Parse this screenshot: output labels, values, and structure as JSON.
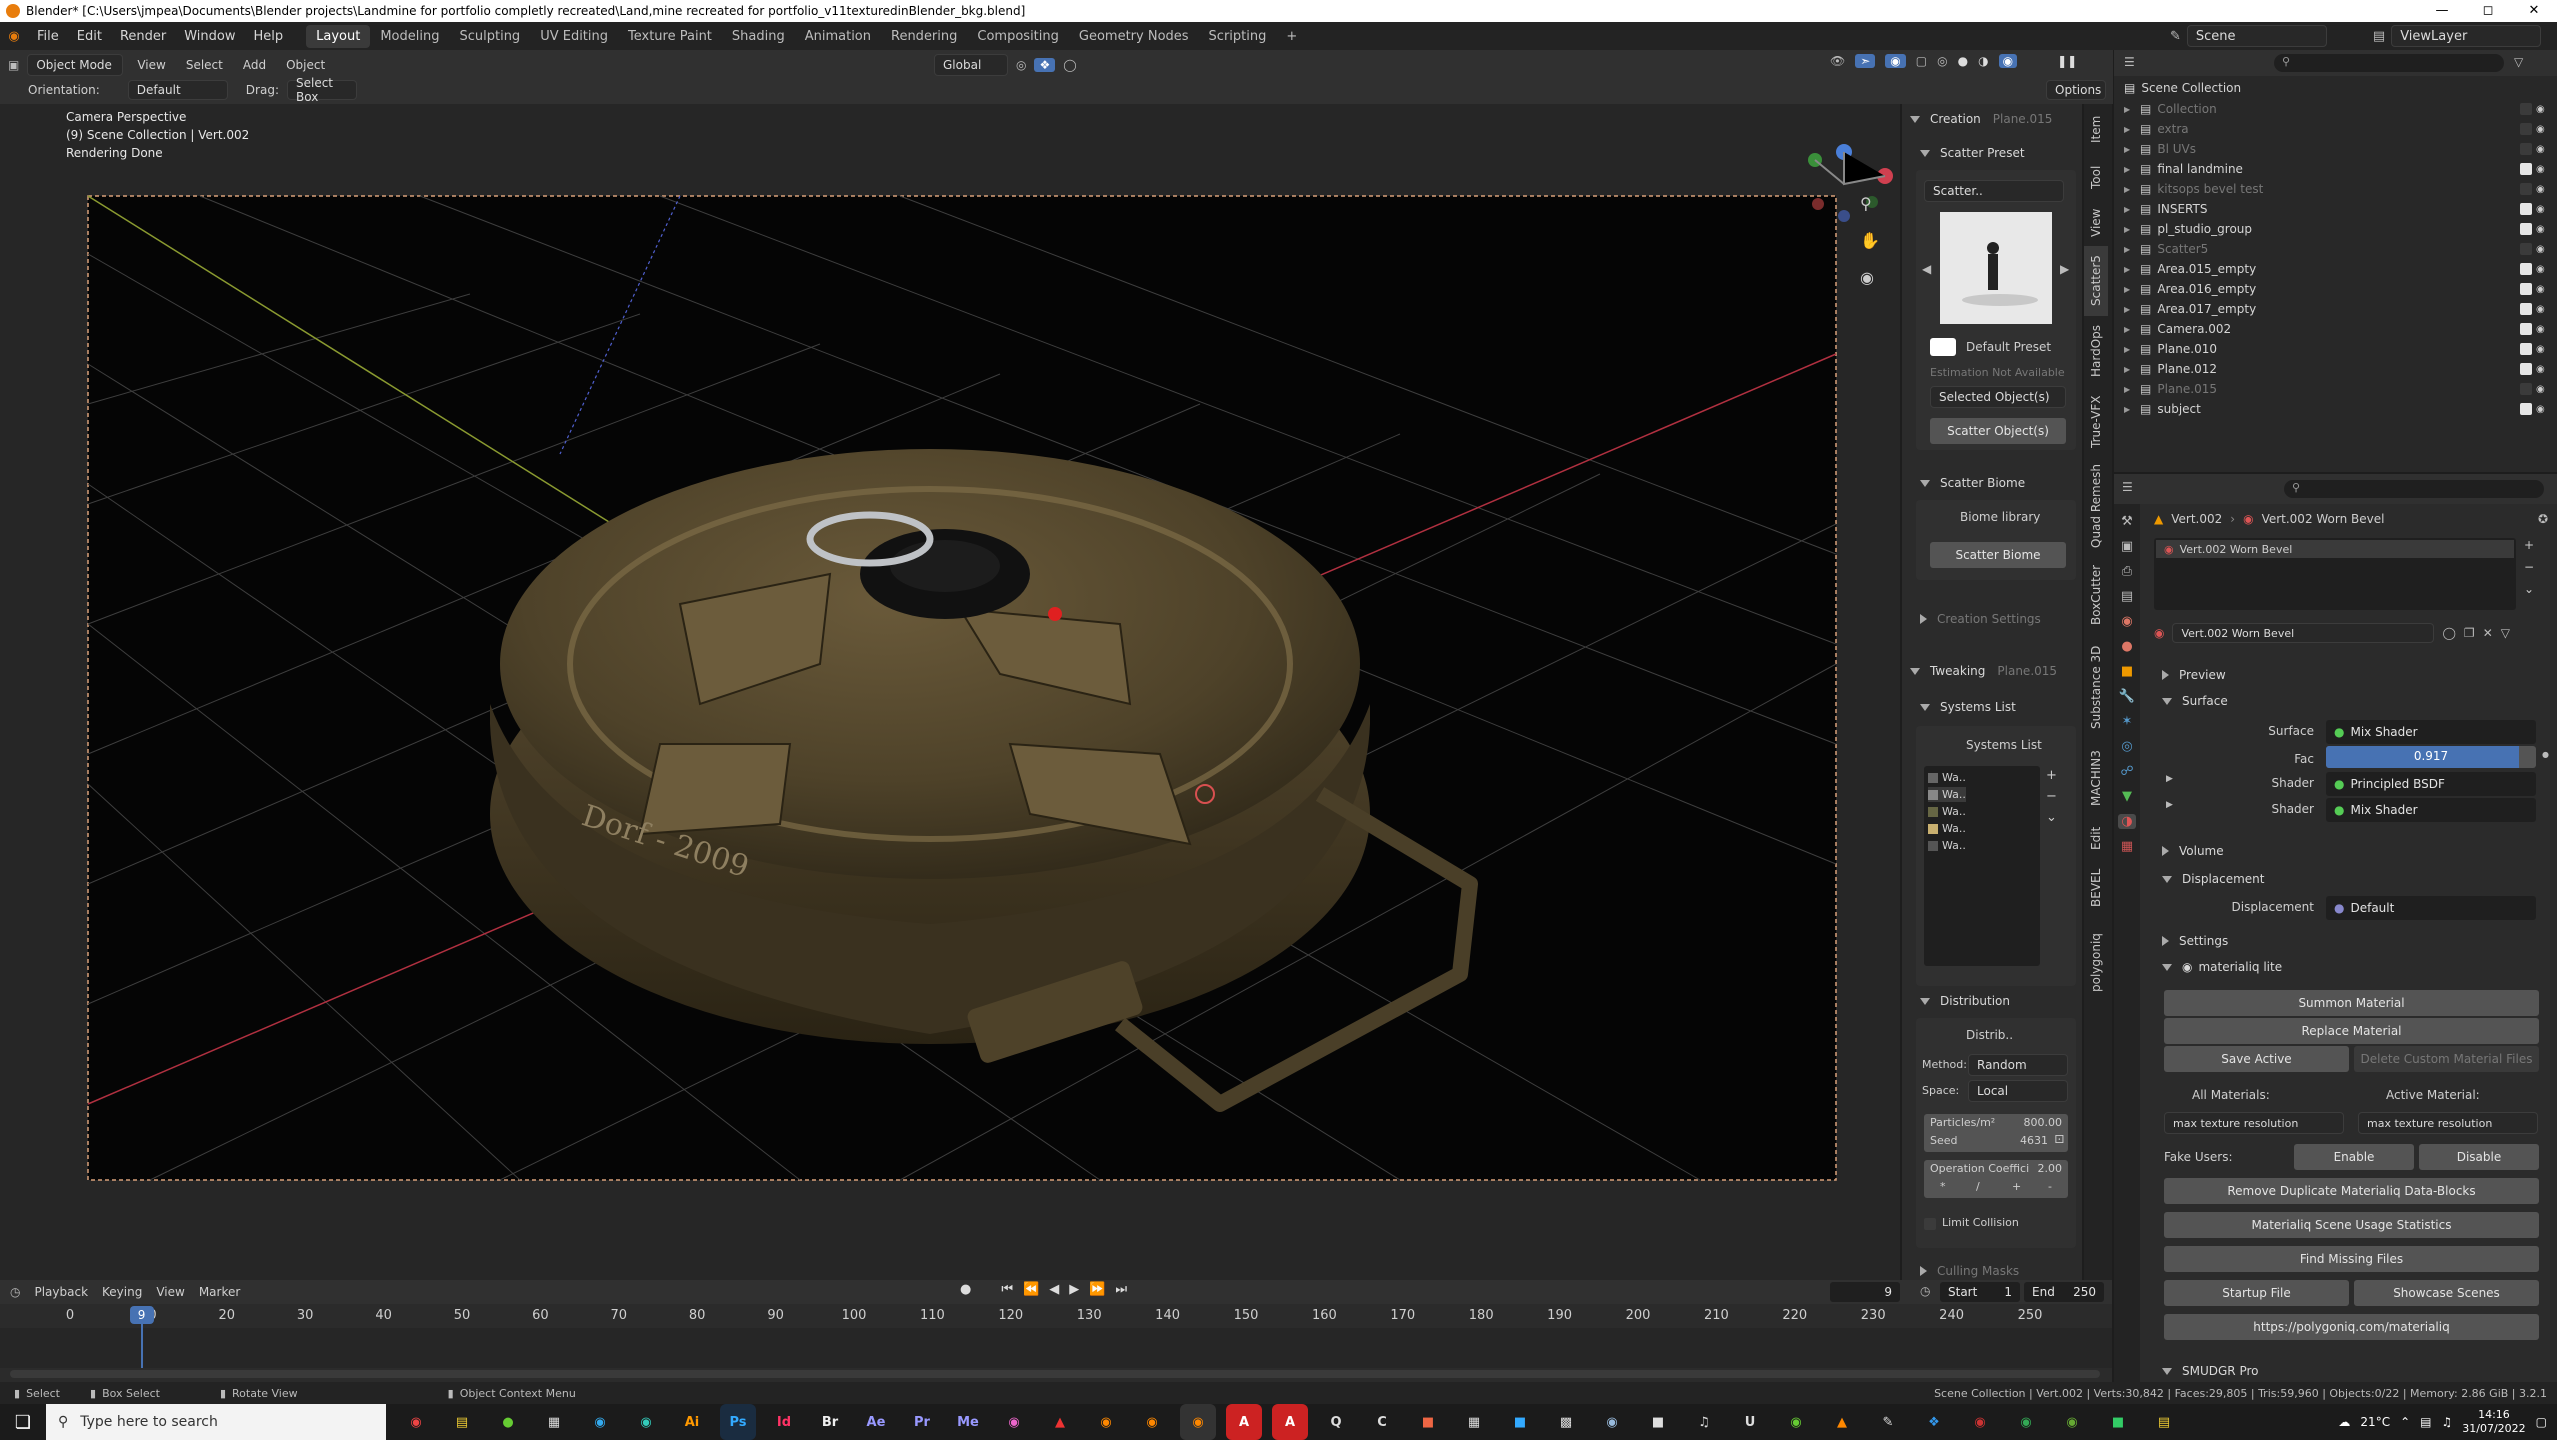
{
  "window": {
    "title": "Blender* [C:\\Users\\jmpea\\Documents\\Blender projects\\Landmine for portfolio completly recreated\\Land,mine recreated for portfolio_v11texturedinBlender_bkg.blend]"
  },
  "menu": [
    "File",
    "Edit",
    "Render",
    "Window",
    "Help"
  ],
  "workspaces": [
    "Layout",
    "Modeling",
    "Sculpting",
    "UV Editing",
    "Texture Paint",
    "Shading",
    "Animation",
    "Rendering",
    "Compositing",
    "Geometry Nodes",
    "Scripting"
  ],
  "scene": {
    "label": "Scene",
    "view_layer": "ViewLayer"
  },
  "header": {
    "mode": "Object Mode",
    "view": "View",
    "select": "Select",
    "add": "Add",
    "object": "Object",
    "transform": "Global",
    "orientation_label": "Orientation:",
    "orientation": "Default",
    "drag_label": "Drag:",
    "drag": "Select Box",
    "options": "Options"
  },
  "viewport": {
    "line1": "Camera Perspective",
    "line2": "(9) Scene Collection | Vert.002",
    "line3": "Rendering Done",
    "stencil1": "Dorf - 2009"
  },
  "npanel": {
    "creation": "Creation",
    "creation_obj": "Plane.015",
    "scatter_preset": "Scatter Preset",
    "scatter_name": "Scatter..",
    "default_preset": "Default Preset",
    "estimation": "Estimation Not Available",
    "selected_objects": "Selected Object(s)",
    "scatter_objects": "Scatter Object(s)",
    "scatter_biome": "Scatter Biome",
    "biome_library": "Biome library",
    "scatter_biome_btn": "Scatter Biome",
    "creation_settings": "Creation Settings",
    "tweaking": "Tweaking",
    "tweaking_obj": "Plane.015",
    "systems_list": "Systems List",
    "systems_list_box": "Systems List",
    "systems": [
      "Wa..",
      "Wa..",
      "Wa..",
      "Wa..",
      "Wa.."
    ],
    "distribution": "Distribution",
    "distrib_box": "Distrib..",
    "method_label": "Method:",
    "method": "Random",
    "space_label": "Space:",
    "space": "Local",
    "particles_label": "Particles/m²",
    "particles": "800.00",
    "seed_label": "Seed",
    "seed": "4631",
    "op_label": "Operation Coeffici",
    "op_value": "2.00",
    "ops": [
      "*",
      "/",
      "+",
      "-"
    ],
    "limit_collision": "Limit Collision",
    "culling": "Culling Masks"
  },
  "vtabs": [
    "Item",
    "Tool",
    "View",
    "Scatter5",
    "HardOps",
    "True-VFX",
    "Quad Remesh",
    "BoxCutter",
    "Substance 3D",
    "MACHIN3",
    "Edit",
    "BEVEL",
    "polygoniq"
  ],
  "outliner": {
    "search_placeholder": "",
    "root": "Scene Collection",
    "items": [
      {
        "name": "Collection",
        "dim": true,
        "indent": 1
      },
      {
        "name": "extra",
        "dim": true,
        "indent": 1
      },
      {
        "name": "Bl UVs",
        "dim": true,
        "indent": 1
      },
      {
        "name": "final landmine",
        "dim": false,
        "indent": 1
      },
      {
        "name": "kitsops bevel test",
        "dim": true,
        "indent": 1
      },
      {
        "name": "INSERTS",
        "dim": false,
        "indent": 1
      },
      {
        "name": "pl_studio_group",
        "dim": false,
        "indent": 1
      },
      {
        "name": "Scatter5",
        "dim": true,
        "indent": 1
      },
      {
        "name": "Area.015_empty",
        "dim": false,
        "indent": 1
      },
      {
        "name": "Area.016_empty",
        "dim": false,
        "indent": 1
      },
      {
        "name": "Area.017_empty",
        "dim": false,
        "indent": 1
      },
      {
        "name": "Camera.002",
        "dim": false,
        "indent": 1
      },
      {
        "name": "Plane.010",
        "dim": false,
        "indent": 1
      },
      {
        "name": "Plane.012",
        "dim": false,
        "indent": 1
      },
      {
        "name": "Plane.015",
        "dim": true,
        "indent": 1
      },
      {
        "name": "subject",
        "dim": false,
        "indent": 1
      }
    ]
  },
  "props": {
    "breadcrumb_obj": "Vert.002",
    "breadcrumb_mat": "Vert.002 Worn Bevel",
    "slot": "Vert.002 Worn Bevel",
    "material": "Vert.002 Worn Bevel",
    "preview": "Preview",
    "surface": "Surface",
    "surface_label": "Surface",
    "surface_value": "Mix Shader",
    "fac_label": "Fac",
    "fac_value": "0.917",
    "fac": 0.917,
    "shader_label": "Shader",
    "shader1": "Principled BSDF",
    "shader2": "Mix Shader",
    "volume": "Volume",
    "displacement": "Displacement",
    "displacement_label": "Displacement",
    "displacement_value": "Default",
    "settings": "Settings",
    "materialiq": "materialiq lite",
    "summon": "Summon Material",
    "replace": "Replace Material",
    "save_active": "Save Active",
    "delete_custom": "Delete Custom Material Files",
    "all_materials": "All Materials:",
    "active_material": "Active Material:",
    "max_tex1": "max texture resolution",
    "max_tex2": "max texture resolution",
    "fake_users": "Fake Users:",
    "enable": "Enable",
    "disable": "Disable",
    "remove_dup": "Remove Duplicate Materialiq Data-Blocks",
    "usage_stats": "Materialiq Scene Usage Statistics",
    "find_missing": "Find Missing Files",
    "startup": "Startup File",
    "showcase": "Showcase Scenes",
    "url": "https://polygoniq.com/materialiq",
    "smudgr": "SMUDGR Pro"
  },
  "timeline": {
    "playback": "Playback",
    "keying": "Keying",
    "view": "View",
    "marker": "Marker",
    "current": "9",
    "start_label": "Start",
    "start": "1",
    "end_label": "End",
    "end": "250",
    "ticks": [
      "0",
      "10",
      "20",
      "30",
      "40",
      "50",
      "60",
      "70",
      "80",
      "90",
      "100",
      "110",
      "120",
      "130",
      "140",
      "150",
      "160",
      "170",
      "180",
      "190",
      "200",
      "210",
      "220",
      "230",
      "240",
      "250"
    ],
    "frame": 9
  },
  "statusbar": {
    "select": "Select",
    "box_select": "Box Select",
    "rotate": "Rotate View",
    "context_menu": "Object Context Menu",
    "stats": "Scene Collection | Vert.002 | Verts:30,842 | Faces:29,805 | Tris:59,960 | Objects:0/22 | Memory: 2.86 GiB | 3.2.1"
  },
  "taskbar": {
    "search_placeholder": "Type here to search",
    "temp": "21°C",
    "time": "14:16",
    "date": "31/07/2022",
    "apps": [
      "Ai",
      "Ps",
      "Id",
      "Br",
      "Ae",
      "Pr",
      "Me"
    ]
  },
  "colors": {
    "accent": "#4772b3",
    "active_tool": "#4772b3",
    "grid": "#3a3a3a",
    "selection": "#f0a040"
  }
}
